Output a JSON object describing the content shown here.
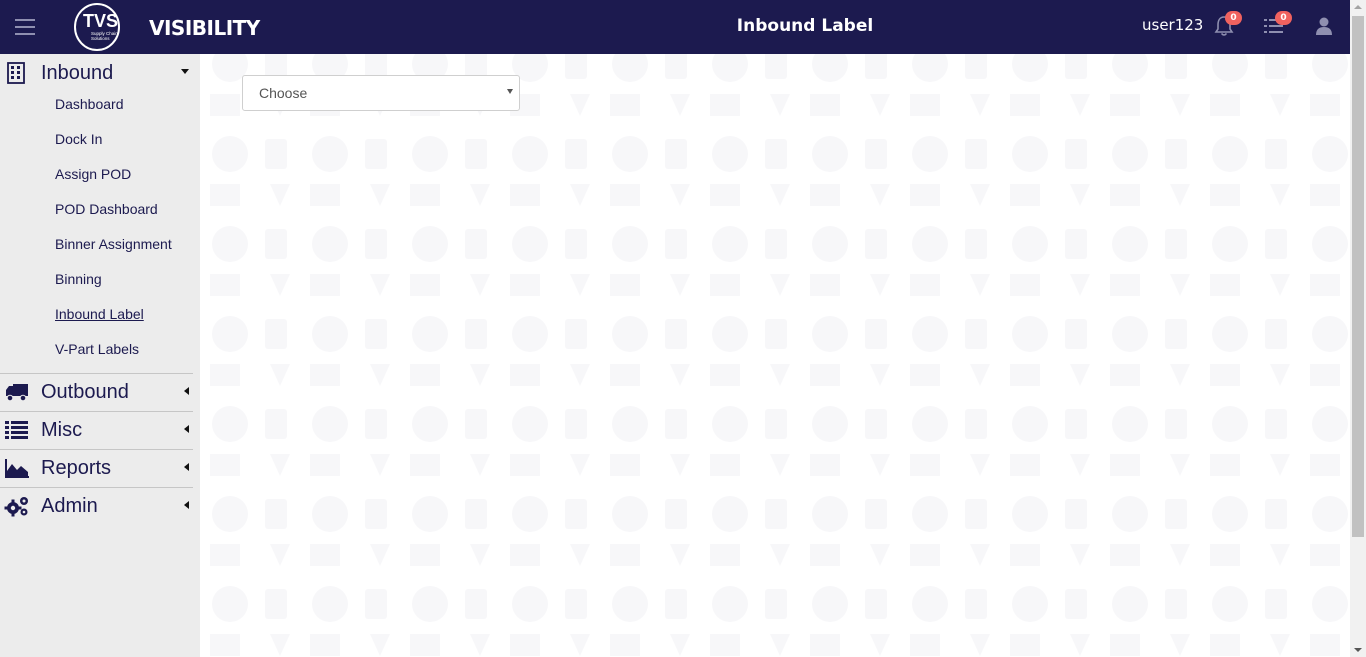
{
  "header": {
    "brand": "VISIBILITY",
    "logo_text": "TVS",
    "logo_subtext_1": "Supply Chain",
    "logo_subtext_2": "Solutions",
    "page_title": "Inbound Label",
    "username": "user123",
    "notifications_count": "0",
    "tasks_count": "0",
    "bar_color": "#1c1a4f",
    "badge_color": "#f0625f",
    "icons": [
      "menu-icon",
      "bell-icon",
      "tasks-list-icon",
      "user-icon"
    ]
  },
  "sidebar": {
    "sections": [
      {
        "label": "Inbound",
        "icon": "building-icon",
        "expanded": true,
        "items": [
          "Dashboard",
          "Dock In",
          "Assign POD",
          "POD Dashboard",
          "Binner Assignment",
          "Binning",
          "Inbound Label",
          "V-Part Labels"
        ],
        "active_item": "Inbound Label"
      },
      {
        "label": "Outbound",
        "icon": "truck-icon",
        "expanded": false
      },
      {
        "label": "Misc",
        "icon": "list-icon",
        "expanded": false
      },
      {
        "label": "Reports",
        "icon": "area-chart-icon",
        "expanded": false
      },
      {
        "label": "Admin",
        "icon": "gears-icon",
        "expanded": false
      }
    ]
  },
  "main": {
    "select": {
      "value": "Choose"
    }
  }
}
